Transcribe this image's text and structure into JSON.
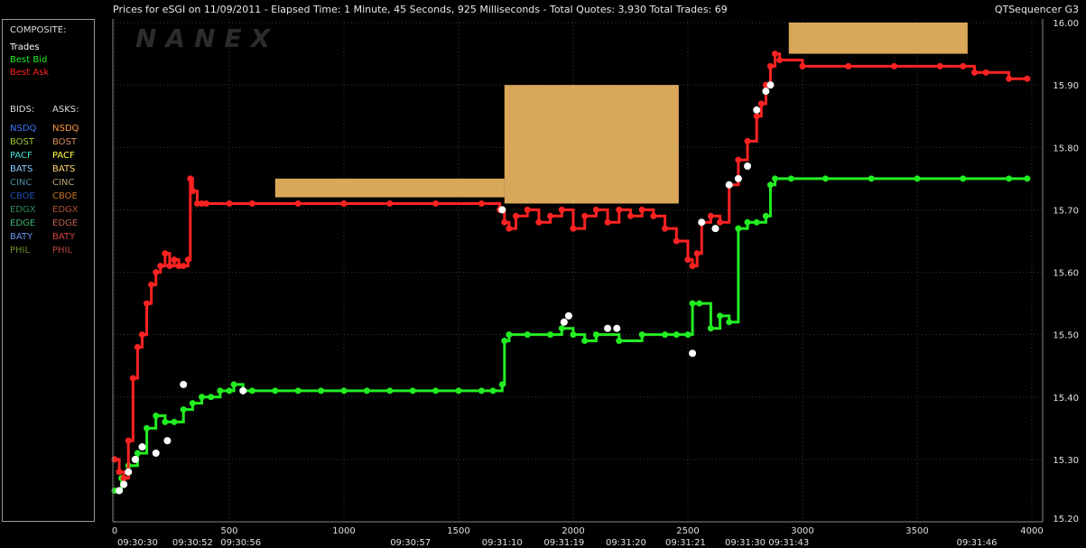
{
  "header": {
    "title": "Prices for  eSGI  on  11/09/2011  -  Elapsed Time: 1 Minute, 45 Seconds, 925 Milliseconds  -  Total Quotes: 3,930  Total Trades: 69",
    "app": "QTSequencer G3"
  },
  "legend": {
    "composite_title": "COMPOSITE:",
    "composite": [
      {
        "label": "Trades",
        "color": "#ffffff"
      },
      {
        "label": "Best Bid",
        "color": "#22ee22"
      },
      {
        "label": "Best Ask",
        "color": "#ff2222"
      }
    ],
    "bids_title": "BIDS:",
    "asks_title": "ASKS:",
    "exchanges": [
      {
        "bid": "NSDQ",
        "bid_color": "#3a7bff",
        "ask": "NSDQ",
        "ask_color": "#ff9a3c"
      },
      {
        "bid": "BOST",
        "bid_color": "#9acd32",
        "ask": "BOST",
        "ask_color": "#d88a5a"
      },
      {
        "bid": "PACF",
        "bid_color": "#40e0d0",
        "ask": "PACF",
        "ask_color": "#ffff40"
      },
      {
        "bid": "BATS",
        "bid_color": "#87cefa",
        "ask": "BATS",
        "ask_color": "#ffd27a"
      },
      {
        "bid": "CINC",
        "bid_color": "#4a8aa0",
        "ask": "CINC",
        "ask_color": "#b8a070"
      },
      {
        "bid": "CBOE",
        "bid_color": "#1e4fb0",
        "ask": "CBOE",
        "ask_color": "#c87020"
      },
      {
        "bid": "EDGX",
        "bid_color": "#2e8b57",
        "ask": "EDGX",
        "ask_color": "#b05030"
      },
      {
        "bid": "EDGE",
        "bid_color": "#3cb371",
        "ask": "EDGE",
        "ask_color": "#c06050"
      },
      {
        "bid": "BATY",
        "bid_color": "#6495ed",
        "ask": "BATY",
        "ask_color": "#d04040"
      },
      {
        "bid": "PHIL",
        "bid_color": "#6b8e23",
        "ask": "PHIL",
        "ask_color": "#c04040"
      }
    ]
  },
  "watermark": "NANEX",
  "chart_data": {
    "type": "scatter",
    "title": "Prices for eSGI on 11/09/2011",
    "xlim": [
      0,
      4000
    ],
    "ylim": [
      15.2,
      16.0
    ],
    "x_ticks": [
      0,
      500,
      1000,
      1500,
      2000,
      2500,
      3000,
      3500,
      4000
    ],
    "y_ticks": [
      15.2,
      15.3,
      15.4,
      15.5,
      15.6,
      15.7,
      15.8,
      15.9,
      16.0
    ],
    "time_labels": [
      {
        "x": 100,
        "label": "09:30:30"
      },
      {
        "x": 340,
        "label": "09:30:52"
      },
      {
        "x": 550,
        "label": "09:30:56"
      },
      {
        "x": 1290,
        "label": "09:30:57"
      },
      {
        "x": 1690,
        "label": "09:31:10"
      },
      {
        "x": 1960,
        "label": "09:31:19"
      },
      {
        "x": 2230,
        "label": "09:31:20"
      },
      {
        "x": 2490,
        "label": "09:31:21"
      },
      {
        "x": 2750,
        "label": "09:31:30"
      },
      {
        "x": 2940,
        "label": "09:31:43"
      },
      {
        "x": 3760,
        "label": "09:31:46"
      }
    ],
    "series": [
      {
        "name": "Best Bid",
        "color": "#22ee22",
        "x": [
          0,
          30,
          60,
          100,
          140,
          180,
          220,
          260,
          300,
          340,
          380,
          420,
          460,
          500,
          520,
          560,
          600,
          700,
          800,
          900,
          1000,
          1100,
          1200,
          1300,
          1400,
          1500,
          1600,
          1650,
          1690,
          1700,
          1720,
          1800,
          1900,
          1950,
          2000,
          2050,
          2100,
          2200,
          2300,
          2400,
          2450,
          2500,
          2520,
          2550,
          2600,
          2640,
          2680,
          2720,
          2760,
          2800,
          2840,
          2860,
          2880,
          2950,
          3100,
          3300,
          3500,
          3700,
          3900,
          3980
        ],
        "y": [
          15.25,
          15.27,
          15.29,
          15.31,
          15.35,
          15.37,
          15.36,
          15.36,
          15.38,
          15.39,
          15.4,
          15.4,
          15.41,
          15.41,
          15.42,
          15.41,
          15.41,
          15.41,
          15.41,
          15.41,
          15.41,
          15.41,
          15.41,
          15.41,
          15.41,
          15.41,
          15.41,
          15.41,
          15.42,
          15.49,
          15.5,
          15.5,
          15.5,
          15.51,
          15.5,
          15.49,
          15.5,
          15.49,
          15.5,
          15.5,
          15.5,
          15.5,
          15.55,
          15.55,
          15.51,
          15.53,
          15.52,
          15.67,
          15.68,
          15.68,
          15.69,
          15.74,
          15.75,
          15.75,
          15.75,
          15.75,
          15.75,
          15.75,
          15.75,
          15.75
        ]
      },
      {
        "name": "Best Ask",
        "color": "#ff2222",
        "x": [
          0,
          20,
          40,
          60,
          80,
          100,
          120,
          140,
          160,
          180,
          200,
          220,
          240,
          260,
          280,
          300,
          320,
          330,
          340,
          360,
          380,
          400,
          500,
          600,
          800,
          1000,
          1200,
          1400,
          1600,
          1680,
          1700,
          1720,
          1750,
          1800,
          1850,
          1900,
          1950,
          2000,
          2050,
          2100,
          2150,
          2200,
          2250,
          2300,
          2350,
          2400,
          2450,
          2500,
          2520,
          2540,
          2560,
          2600,
          2640,
          2680,
          2720,
          2760,
          2800,
          2820,
          2840,
          2860,
          2880,
          2900,
          3000,
          3200,
          3400,
          3600,
          3700,
          3750,
          3800,
          3900,
          3980
        ],
        "y": [
          15.3,
          15.28,
          15.27,
          15.33,
          15.43,
          15.48,
          15.5,
          15.55,
          15.58,
          15.6,
          15.61,
          15.63,
          15.61,
          15.62,
          15.61,
          15.61,
          15.62,
          15.75,
          15.73,
          15.71,
          15.71,
          15.71,
          15.71,
          15.71,
          15.71,
          15.71,
          15.71,
          15.71,
          15.71,
          15.7,
          15.68,
          15.67,
          15.69,
          15.7,
          15.68,
          15.69,
          15.7,
          15.67,
          15.69,
          15.7,
          15.68,
          15.7,
          15.69,
          15.7,
          15.69,
          15.67,
          15.65,
          15.62,
          15.61,
          15.63,
          15.68,
          15.69,
          15.68,
          15.74,
          15.78,
          15.81,
          15.85,
          15.87,
          15.9,
          15.93,
          15.95,
          15.94,
          15.93,
          15.93,
          15.93,
          15.93,
          15.93,
          15.92,
          15.92,
          15.91,
          15.91
        ]
      },
      {
        "name": "Trades",
        "color": "#ffffff",
        "x": [
          20,
          40,
          60,
          90,
          120,
          180,
          230,
          300,
          560,
          1690,
          1960,
          1980,
          2150,
          2190,
          2520,
          2560,
          2620,
          2680,
          2720,
          2760,
          2800,
          2840,
          2860
        ],
        "y": [
          15.25,
          15.26,
          15.28,
          15.3,
          15.32,
          15.31,
          15.33,
          15.42,
          15.41,
          15.7,
          15.52,
          15.53,
          15.51,
          15.51,
          15.47,
          15.68,
          15.67,
          15.74,
          15.75,
          15.77,
          15.86,
          15.89,
          15.9
        ]
      }
    ],
    "ask_band": [
      {
        "x": [
          700,
          1700
        ],
        "y": [
          15.72,
          15.75
        ]
      },
      {
        "x": [
          1700,
          2460
        ],
        "y": [
          15.71,
          15.9
        ]
      },
      {
        "x": [
          2940,
          3720
        ],
        "y": [
          15.95,
          16.0
        ]
      }
    ]
  }
}
